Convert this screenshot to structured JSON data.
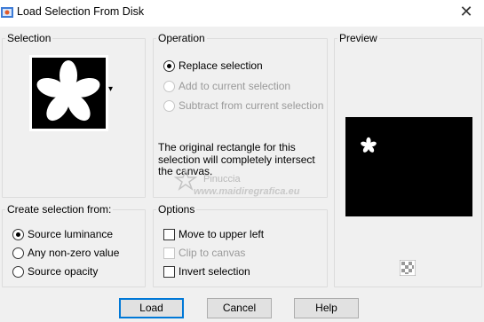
{
  "window": {
    "title": "Load Selection From Disk",
    "close_glyph": "✕",
    "icon": "app-icon"
  },
  "selection_group": {
    "title": "Selection",
    "dropdown_glyph": "▾",
    "thumbnail": "flower-shape-icon"
  },
  "operation_group": {
    "title": "Operation",
    "options": [
      {
        "label": "Replace selection",
        "checked": true,
        "enabled": true
      },
      {
        "label": "Add to current selection",
        "checked": false,
        "enabled": false
      },
      {
        "label": "Subtract from current selection",
        "checked": false,
        "enabled": false
      }
    ],
    "message_line1": "The original rectangle for this",
    "message_line2": "selection will completely intersect",
    "message_line3": "the canvas."
  },
  "preview_group": {
    "title": "Preview",
    "zoom_icon": "checkerboard-icon"
  },
  "create_from_group": {
    "title": "Create selection from:",
    "options": [
      {
        "label": "Source luminance",
        "checked": true
      },
      {
        "label": "Any non-zero value",
        "checked": false
      },
      {
        "label": "Source opacity",
        "checked": false
      }
    ]
  },
  "options_group": {
    "title": "Options",
    "checks": [
      {
        "label": "Move to upper left",
        "checked": false,
        "enabled": true
      },
      {
        "label": "Clip to canvas",
        "checked": false,
        "enabled": false
      },
      {
        "label": "Invert selection",
        "checked": false,
        "enabled": true
      }
    ]
  },
  "watermark": {
    "line1": "Pinuccia",
    "line2": "www.maidiregrafica.eu"
  },
  "buttons": {
    "load": "Load",
    "cancel": "Cancel",
    "help": "Help"
  },
  "colors": {
    "accent": "#0078d7",
    "dialog_bg": "#f0f0f0"
  }
}
